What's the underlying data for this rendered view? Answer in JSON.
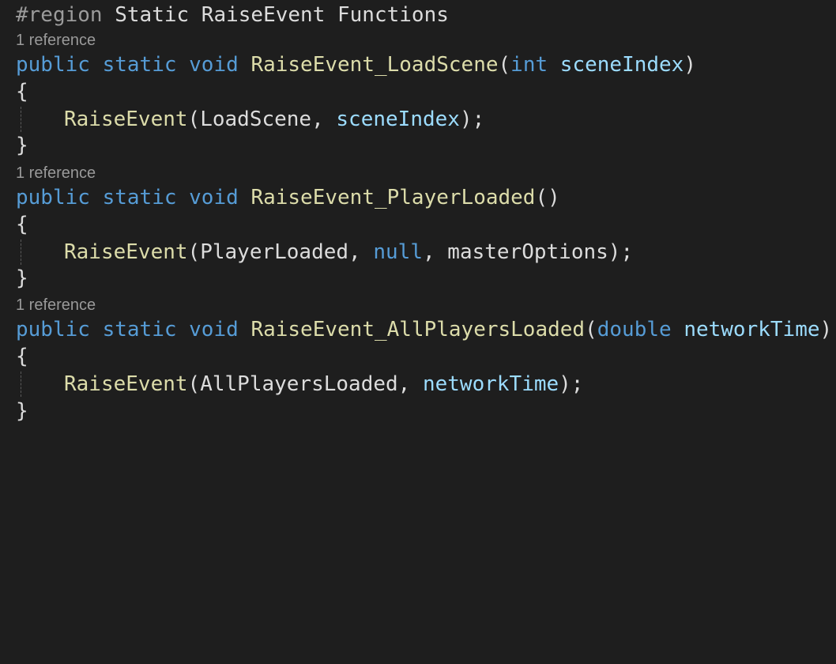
{
  "region": {
    "directive": "#region",
    "name": "Static RaiseEvent Functions"
  },
  "tokens": {
    "public": "public",
    "static": "static",
    "void": "void",
    "open_brace": "{",
    "close_brace": "}",
    "open_paren": "(",
    "close_paren": ")",
    "close_stmt": ");",
    "comma": ", ",
    "raise_event": "RaiseEvent"
  },
  "methods": [
    {
      "codelens": "1 reference",
      "name": "RaiseEvent_LoadScene",
      "param_type": "int",
      "param_name": "sceneIndex",
      "call_first_arg": "LoadScene",
      "call_second_arg": "sceneIndex"
    },
    {
      "codelens": "1 reference",
      "name": "RaiseEvent_PlayerLoaded",
      "signature_parens": "()",
      "call_first_arg": "PlayerLoaded",
      "call_second_arg": "null",
      "call_third_arg": "masterOptions"
    },
    {
      "codelens": "1 reference",
      "name": "RaiseEvent_AllPlayersLoaded",
      "param_type": "double",
      "param_name": "networkTime",
      "call_first_arg": "AllPlayersLoaded",
      "call_second_arg": "networkTime"
    }
  ],
  "colors": {
    "background": "#1e1e1e",
    "keyword": "#569cd6",
    "function": "#dcdcaa",
    "parameter": "#9cdcfe",
    "plain": "#dcdcdc",
    "codelens": "#999999",
    "preprocessor": "#9b9b9b"
  }
}
